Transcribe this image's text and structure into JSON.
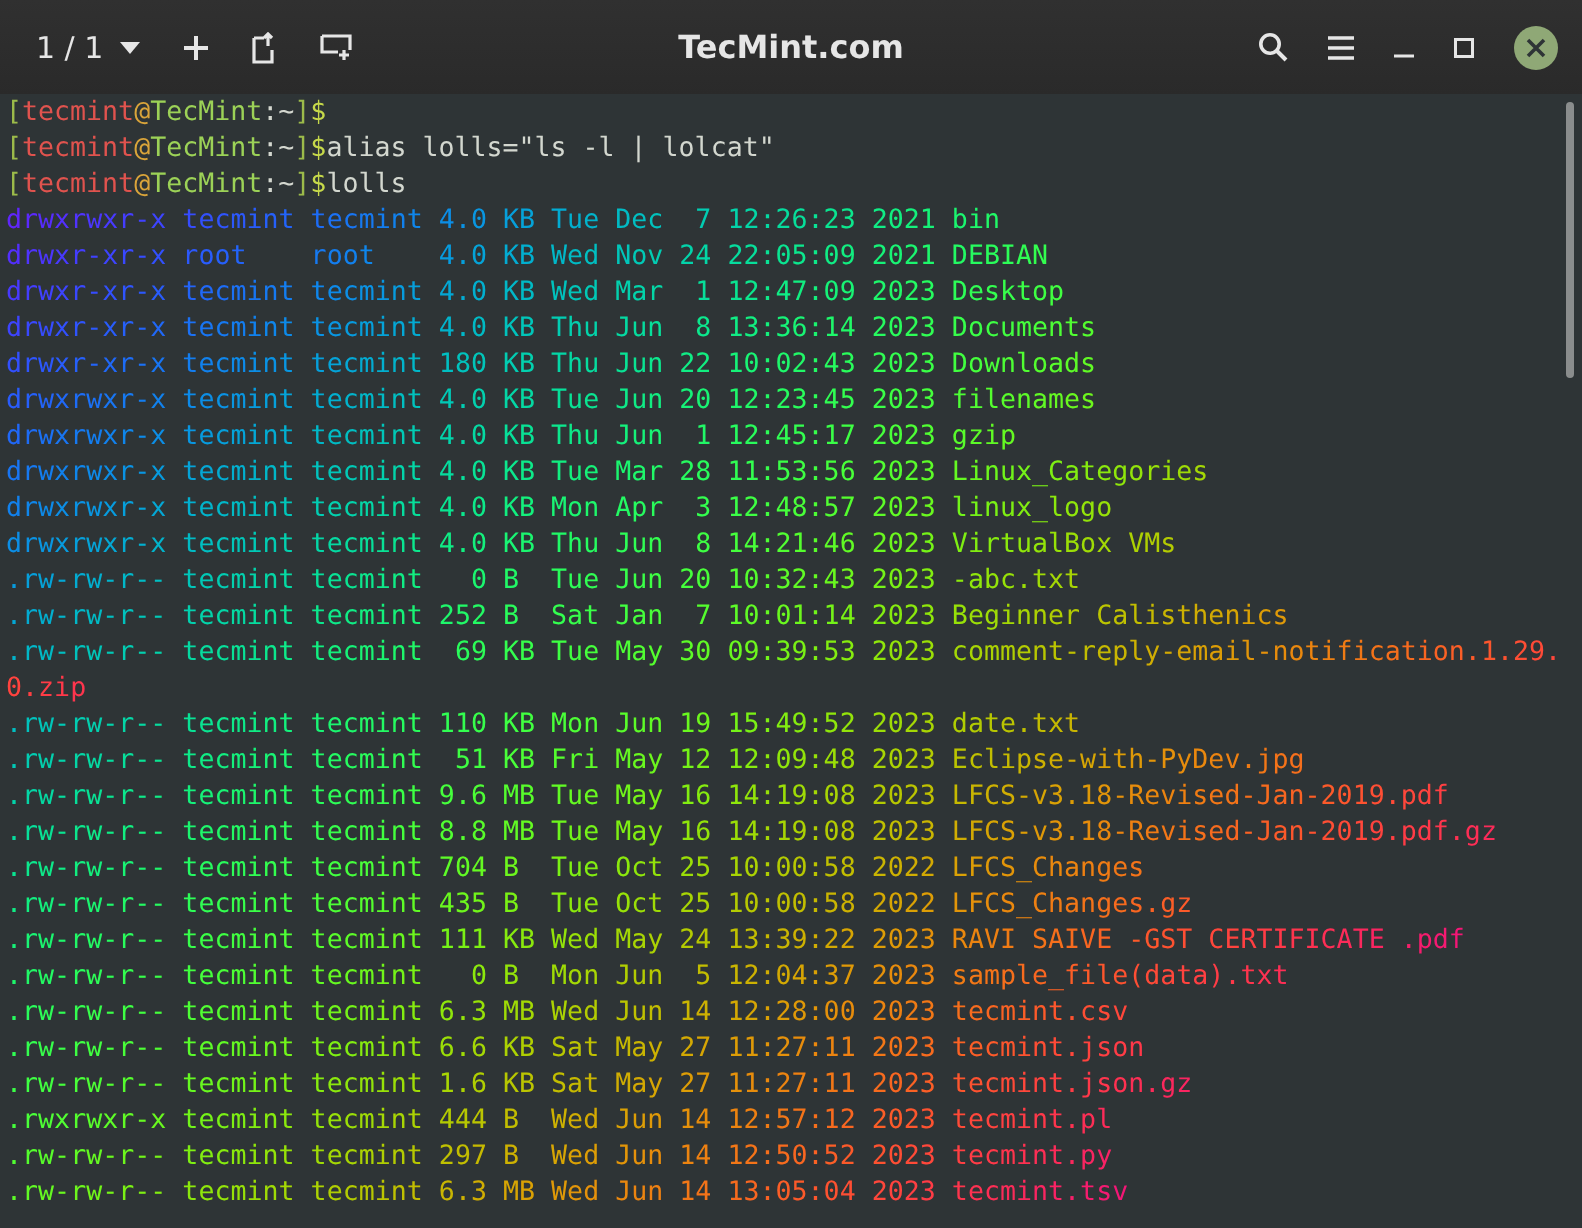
{
  "header": {
    "tab_counter": "1 / 1",
    "title": "TecMint.com"
  },
  "prompts": [
    {
      "open": "[",
      "user": "tecmint",
      "at": "@",
      "host": "TecMint",
      "sep": ":",
      "path": "~",
      "close": "]",
      "sign": "$"
    },
    {
      "open": "[",
      "user": "tecmint",
      "at": "@",
      "host": "TecMint",
      "sep": ":",
      "path": "~",
      "close": "]",
      "sign": "$",
      "command": "alias lolls=\"ls -l | lolcat\""
    },
    {
      "open": "[",
      "user": "tecmint",
      "at": "@",
      "host": "TecMint",
      "sep": ":",
      "path": "~",
      "close": "]",
      "sign": "$",
      "command": "lolls"
    }
  ],
  "listing": [
    "drwxrwxr-x tecmint tecmint 4.0 KB Tue Dec  7 12:26:23 2021 bin",
    "drwxr-xr-x root    root    4.0 KB Wed Nov 24 22:05:09 2021 DEBIAN",
    "drwxr-xr-x tecmint tecmint 4.0 KB Wed Mar  1 12:47:09 2023 Desktop",
    "drwxr-xr-x tecmint tecmint 4.0 KB Thu Jun  8 13:36:14 2023 Documents",
    "drwxr-xr-x tecmint tecmint 180 KB Thu Jun 22 10:02:43 2023 Downloads",
    "drwxrwxr-x tecmint tecmint 4.0 KB Tue Jun 20 12:23:45 2023 filenames",
    "drwxrwxr-x tecmint tecmint 4.0 KB Thu Jun  1 12:45:17 2023 gzip",
    "drwxrwxr-x tecmint tecmint 4.0 KB Tue Mar 28 11:53:56 2023 Linux_Categories",
    "drwxrwxr-x tecmint tecmint 4.0 KB Mon Apr  3 12:48:57 2023 linux_logo",
    "drwxrwxr-x tecmint tecmint 4.0 KB Thu Jun  8 14:21:46 2023 VirtualBox VMs",
    ".rw-rw-r-- tecmint tecmint   0 B  Tue Jun 20 10:32:43 2023 -abc.txt",
    ".rw-rw-r-- tecmint tecmint 252 B  Sat Jan  7 10:01:14 2023 Beginner Calisthenics",
    ".rw-rw-r-- tecmint tecmint  69 KB Tue May 30 09:39:53 2023 comment-reply-email-notification.1.29.0.zip",
    ".rw-rw-r-- tecmint tecmint 110 KB Mon Jun 19 15:49:52 2023 date.txt",
    ".rw-rw-r-- tecmint tecmint  51 KB Fri May 12 12:09:48 2023 Eclipse-with-PyDev.jpg",
    ".rw-rw-r-- tecmint tecmint 9.6 MB Tue May 16 14:19:08 2023 LFCS-v3.18-Revised-Jan-2019.pdf",
    ".rw-rw-r-- tecmint tecmint 8.8 MB Tue May 16 14:19:08 2023 LFCS-v3.18-Revised-Jan-2019.pdf.gz",
    ".rw-rw-r-- tecmint tecmint 704 B  Tue Oct 25 10:00:58 2022 LFCS_Changes",
    ".rw-rw-r-- tecmint tecmint 435 B  Tue Oct 25 10:00:58 2022 LFCS_Changes.gz",
    ".rw-rw-r-- tecmint tecmint 111 KB Wed May 24 13:39:22 2023 RAVI SAIVE -GST CERTIFICATE .pdf",
    ".rw-rw-r-- tecmint tecmint   0 B  Mon Jun  5 12:04:37 2023 sample_file(data).txt",
    ".rw-rw-r-- tecmint tecmint 6.3 MB Wed Jun 14 12:28:00 2023 tecmint.csv",
    ".rw-rw-r-- tecmint tecmint 6.6 KB Sat May 27 11:27:11 2023 tecmint.json",
    ".rw-rw-r-- tecmint tecmint 1.6 KB Sat May 27 11:27:11 2023 tecmint.json.gz",
    ".rwxrwxr-x tecmint tecmint 444 B  Wed Jun 14 12:57:12 2023 tecmint.pl",
    ".rw-rw-r-- tecmint tecmint 297 B  Wed Jun 14 12:50:52 2023 tecmint.py",
    ".rw-rw-r-- tecmint tecmint 6.3 MB Wed Jun 14 13:05:04 2023 tecmint.tsv"
  ]
}
